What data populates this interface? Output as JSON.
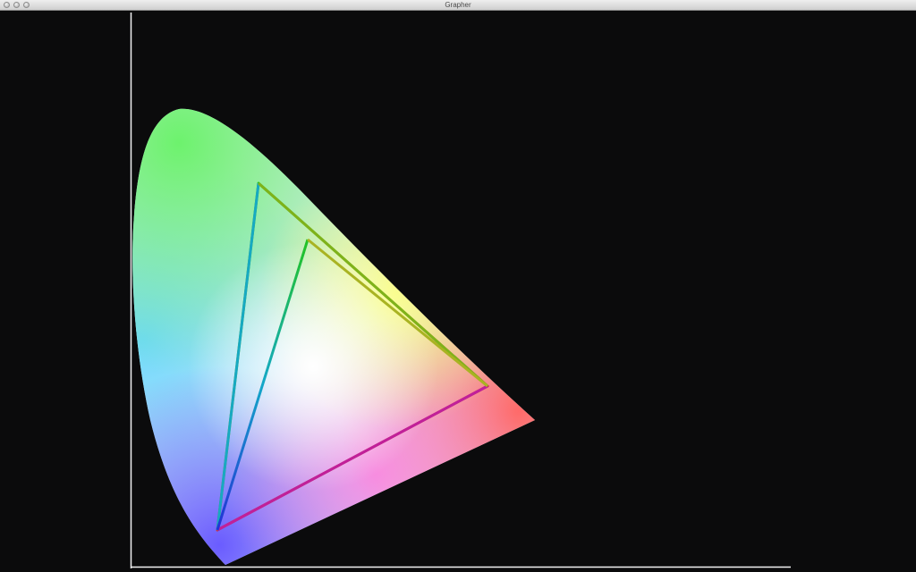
{
  "window": {
    "title": "Grapher"
  },
  "icons": {
    "close": "close-icon",
    "minimize": "minimize-icon",
    "zoom": "zoom-icon"
  },
  "colors": {
    "background": "#0b0b0c",
    "axis": "#f2f2f2",
    "titlebar": "#e2e2e2"
  },
  "chart_data": {
    "type": "scatter",
    "title": "",
    "xlabel": "",
    "ylabel": "",
    "grid": false,
    "description_series": [
      {
        "shape": "spectral locus (horseshoe)"
      },
      {
        "shape": "outer gamut triangle"
      },
      {
        "shape": "inner gamut triangle"
      }
    ]
  }
}
